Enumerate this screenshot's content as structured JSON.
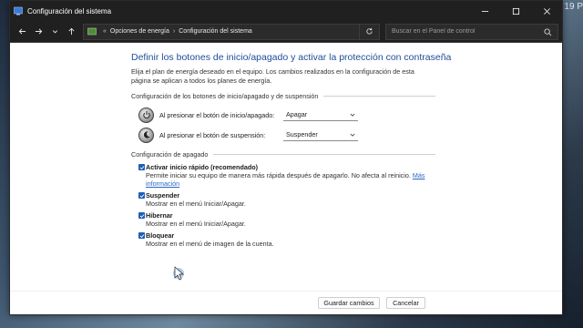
{
  "window": {
    "title": "Configuración del sistema"
  },
  "desktop": {
    "clock_fragment": "19 P"
  },
  "address": {
    "crumb1": "Opciones de energía",
    "crumb2": "Configuración del sistema",
    "search_placeholder": "Buscar en el Panel de control"
  },
  "main": {
    "heading": "Definir los botones de inicio/apagado y activar la protección con contraseña",
    "description": "Elija el plan de energía deseado en el equipo. Los cambios realizados en la configuración de esta página se aplican a todos los planes de energía.",
    "buttons_section": "Configuración de los botones de inicio/apagado y de suspensión",
    "power_label": "Al presionar el botón de inicio/apagado:",
    "power_value": "Apagar",
    "sleep_label": "Al presionar el botón de suspensión:",
    "sleep_value": "Suspender",
    "shutdown_section": "Configuración de apagado",
    "options": [
      {
        "title": "Activar inicio rápido (recomendado)",
        "desc": "Permite iniciar su equipo de manera más rápida después de apagarlo. No afecta al reinicio.",
        "link": "Más información",
        "checked": true
      },
      {
        "title": "Suspender",
        "desc": "Mostrar en el menú Iniciar/Apagar.",
        "checked": true
      },
      {
        "title": "Hibernar",
        "desc": "Mostrar en el menú Iniciar/Apagar.",
        "checked": true
      },
      {
        "title": "Bloquear",
        "desc": "Mostrar en el menú de imagen de la cuenta.",
        "checked": true
      }
    ]
  },
  "footer": {
    "save": "Guardar cambios",
    "cancel": "Cancelar"
  },
  "colors": {
    "accent": "#1f5fb4",
    "heading": "#1f4e99",
    "link": "#2a66c8",
    "titlebar": "#202020"
  },
  "icons": [
    "app-icon",
    "back-arrow-icon",
    "forward-arrow-icon",
    "dropdown-icon",
    "up-arrow-icon",
    "control-panel-icon",
    "refresh-icon",
    "search-icon",
    "power-icon",
    "moon-icon",
    "checkmark-icon",
    "minimize-icon",
    "maximize-icon",
    "close-icon",
    "mouse-cursor-icon"
  ]
}
